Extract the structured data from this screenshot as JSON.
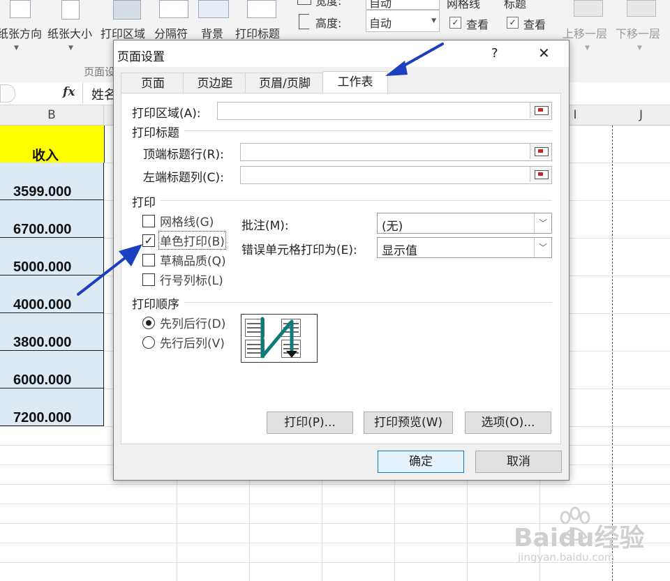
{
  "ribbon": {
    "buttons": [
      {
        "label": "纸张方向"
      },
      {
        "label": "纸张大小"
      },
      {
        "label": "打印区域"
      },
      {
        "label": "分隔符"
      },
      {
        "label": "背景"
      },
      {
        "label": "打印标题"
      }
    ],
    "group_label": "页面设",
    "width_label": "宽度:",
    "width_value": "自动",
    "height_label": "高度:",
    "height_value": "自动",
    "gridlines_group": "网格线",
    "headings_group": "标题",
    "gridlines_view": "查看",
    "headings_view": "查看",
    "bring_forward": "上移一层",
    "send_backward": "下移一层"
  },
  "formula_bar": {
    "fx": "fx",
    "content": "姓名"
  },
  "sheet": {
    "columns": [
      "B",
      "I",
      "J"
    ],
    "header_cell": "收入",
    "values": [
      "3599.000",
      "6700.000",
      "5000.000",
      "4000.000",
      "3800.000",
      "6000.000",
      "7200.000"
    ],
    "colors": {
      "header": "#ffff00",
      "data": "#dde9f3"
    }
  },
  "dialog": {
    "title": "页面设置",
    "help": "?",
    "close": "✕",
    "tabs": [
      {
        "label": "页面"
      },
      {
        "label": "页边距"
      },
      {
        "label": "页眉/页脚"
      },
      {
        "label": "工作表"
      }
    ],
    "active_tab": "工作表",
    "print_area_label": "打印区域(A):",
    "print_titles_section": "打印标题",
    "top_rows_label": "顶端标题行(R):",
    "left_cols_label": "左端标题列(C):",
    "print_section": "打印",
    "checkboxes": [
      {
        "label": "网格线(G)",
        "checked": false
      },
      {
        "label": "单色打印(B)",
        "checked": true
      },
      {
        "label": "草稿品质(Q)",
        "checked": false
      },
      {
        "label": "行号列标(L)",
        "checked": false
      }
    ],
    "comments_label": "批注(M):",
    "comments_value": "(无)",
    "errors_label": "错误单元格打印为(E):",
    "errors_value": "显示值",
    "order_section": "打印顺序",
    "radios": [
      {
        "label": "先列后行(D)",
        "selected": true
      },
      {
        "label": "先行后列(V)",
        "selected": false
      }
    ],
    "print_button": "打印(P)...",
    "preview_button": "打印预览(W)",
    "options_button": "选项(O)...",
    "ok_button": "确定",
    "cancel_button": "取消"
  },
  "watermark": {
    "brand": "Baidu经验",
    "url": "jingyan.baidu.com"
  },
  "colors": {
    "arrow": "#1a3fbf",
    "accent": "#0078d7"
  }
}
